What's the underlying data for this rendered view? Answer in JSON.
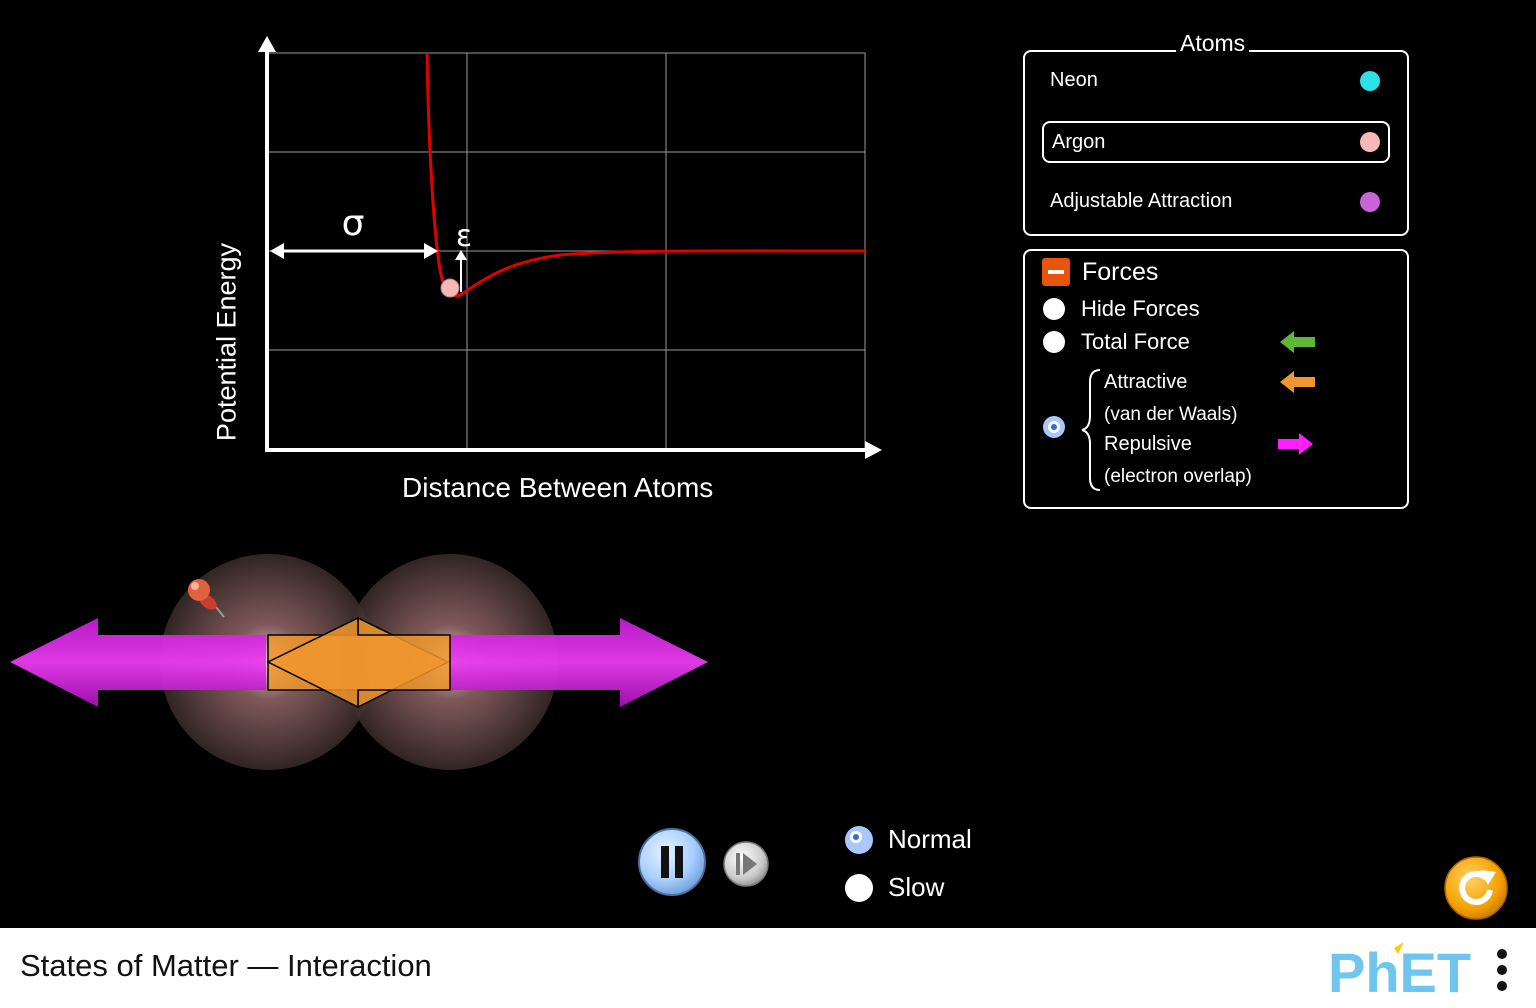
{
  "graph": {
    "x_axis_label": "Distance Between Atoms",
    "y_axis_label": "Potential Energy",
    "sigma_label": "σ",
    "epsilon_label": "ε"
  },
  "atoms_panel": {
    "title": "Atoms",
    "items": [
      {
        "label": "Neon",
        "color": "#2ee0e8",
        "selected": false
      },
      {
        "label": "Argon",
        "color": "#f7b8b8",
        "selected": true
      },
      {
        "label": "Adjustable Attraction",
        "color": "#c964d6",
        "selected": false
      }
    ]
  },
  "forces_panel": {
    "title": "Forces",
    "options": [
      {
        "label": "Hide Forces",
        "selected": false
      },
      {
        "label": "Total Force",
        "selected": false,
        "arrow_color": "#5fb835"
      },
      {
        "label": "Attractive",
        "sublabel": "(van der Waals)",
        "arrow_color": "#f0962c",
        "selected": true
      },
      {
        "label": "Repulsive",
        "sublabel": "(electron overlap)",
        "arrow_color": "#ff1fff"
      }
    ]
  },
  "playback": {
    "speed_options": [
      {
        "label": "Normal",
        "selected": true
      },
      {
        "label": "Slow",
        "selected": false
      }
    ]
  },
  "footer": {
    "title": "States of Matter — Interaction",
    "brand": "PhET"
  },
  "colors": {
    "curve": "#e00000",
    "repulsive": "#b010c0",
    "attractive": "#f0962c",
    "reset": "#f5a000"
  }
}
